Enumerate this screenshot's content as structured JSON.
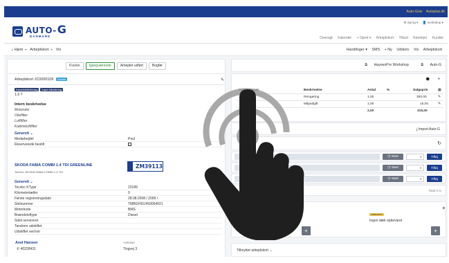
{
  "topbar": {
    "links": [
      "Auto-Gulv",
      "Autoplus.dk"
    ]
  },
  "brand": {
    "name": "AUTO-",
    "g": "G",
    "country": "DANMARK"
  },
  "header": {
    "user_items": [
      "⚙ Sprog ▾",
      "👤 workshop ▾"
    ],
    "nav_items": [
      "Oversigt",
      "Kalender",
      "+ Opret ▾",
      "Arbejdskort",
      "Tilbud",
      "Kørelejer",
      "Kunder"
    ]
  },
  "breadcrumb": {
    "home": "Hjem",
    "section": "Arbejdskort",
    "current": "Vis"
  },
  "crumb_actions": [
    "Handlinger ▾",
    "SMS",
    "+ Ny",
    "Udskriv",
    "Vis",
    "Arbejdskort"
  ],
  "status_buttons": [
    "Kladde",
    "Igangværende",
    "Arbejdet udført",
    "Bogfør"
  ],
  "card": {
    "title": "Arbejdskort JC0000109",
    "badge": "Kladde"
  },
  "labels": [
    "Kørselsbilletforsøg",
    "Ingen håndtering"
  ],
  "mileage": "1,6 T",
  "intern": {
    "heading": "Intern beskrivelse",
    "lines": [
      "Motorolie",
      "Oliefilter",
      "Luftfilter",
      "Kabineluftfilter"
    ]
  },
  "generelt_label": "Generelt ⌄",
  "general_fields": [
    {
      "k": "Medarbejder",
      "v": "Poul"
    },
    {
      "k": "Reserverede bestilt",
      "v": ""
    }
  ],
  "car": {
    "title": "SKODA FABIA COMBI 1.4 TDI GREENLINE",
    "subtitle": "TecDoc: SKODA FABIA COMBI 1.4 TDI",
    "plate": "ZM39113"
  },
  "vehicle_fields": [
    {
      "k": "Tecdoc KType",
      "v": "23189"
    },
    {
      "k": "Kilometertæller",
      "v": "0"
    },
    {
      "k": "Første registreringsdato",
      "v": "28.08.2008 / 2009 /"
    },
    {
      "k": "Stelnummer",
      "v": "TMBGF65J493054021"
    },
    {
      "k": "Motorkode",
      "v": "BMS"
    },
    {
      "k": "Brændstoftype",
      "v": "Diesel"
    },
    {
      "k": "Sidst serviceret",
      "v": ""
    },
    {
      "k": "Tandrem udskiftet",
      "v": ""
    },
    {
      "k": "Udskiftet ved km",
      "v": ""
    }
  ],
  "customer": {
    "name": "Axel Hansen",
    "phone": "40228431",
    "addr_label": "Adresse",
    "address": "Tingvej 3"
  },
  "right_buttons": [
    "HaynesPro Workshop",
    "Auto-G"
  ],
  "table": {
    "headers": [
      "Varenummer",
      "Beskrivelse",
      "Antal",
      "%",
      "Salgspris"
    ],
    "rows": [
      {
        "num": "",
        "desc": "Rengøring",
        "qty": "1,00",
        "price": "300,00"
      },
      {
        "num": "ENV",
        "desc": "Miljøafgift",
        "qty": "1,00",
        "price": "15,00"
      }
    ],
    "total_label": "(ekskl)",
    "total_qty": "2,00",
    "total_price": "315,00"
  },
  "import_label": "Import Auto-G",
  "task_start": "Start",
  "task_add": "Tilføj",
  "total_time": "Total 0 m",
  "messages": {
    "left": "Ingen meddelelser",
    "right_tag": "Indleveret",
    "right": "Ingen dæk opbevaret"
  },
  "attached_label": "Tilknyttet arbejdskort ⌄"
}
